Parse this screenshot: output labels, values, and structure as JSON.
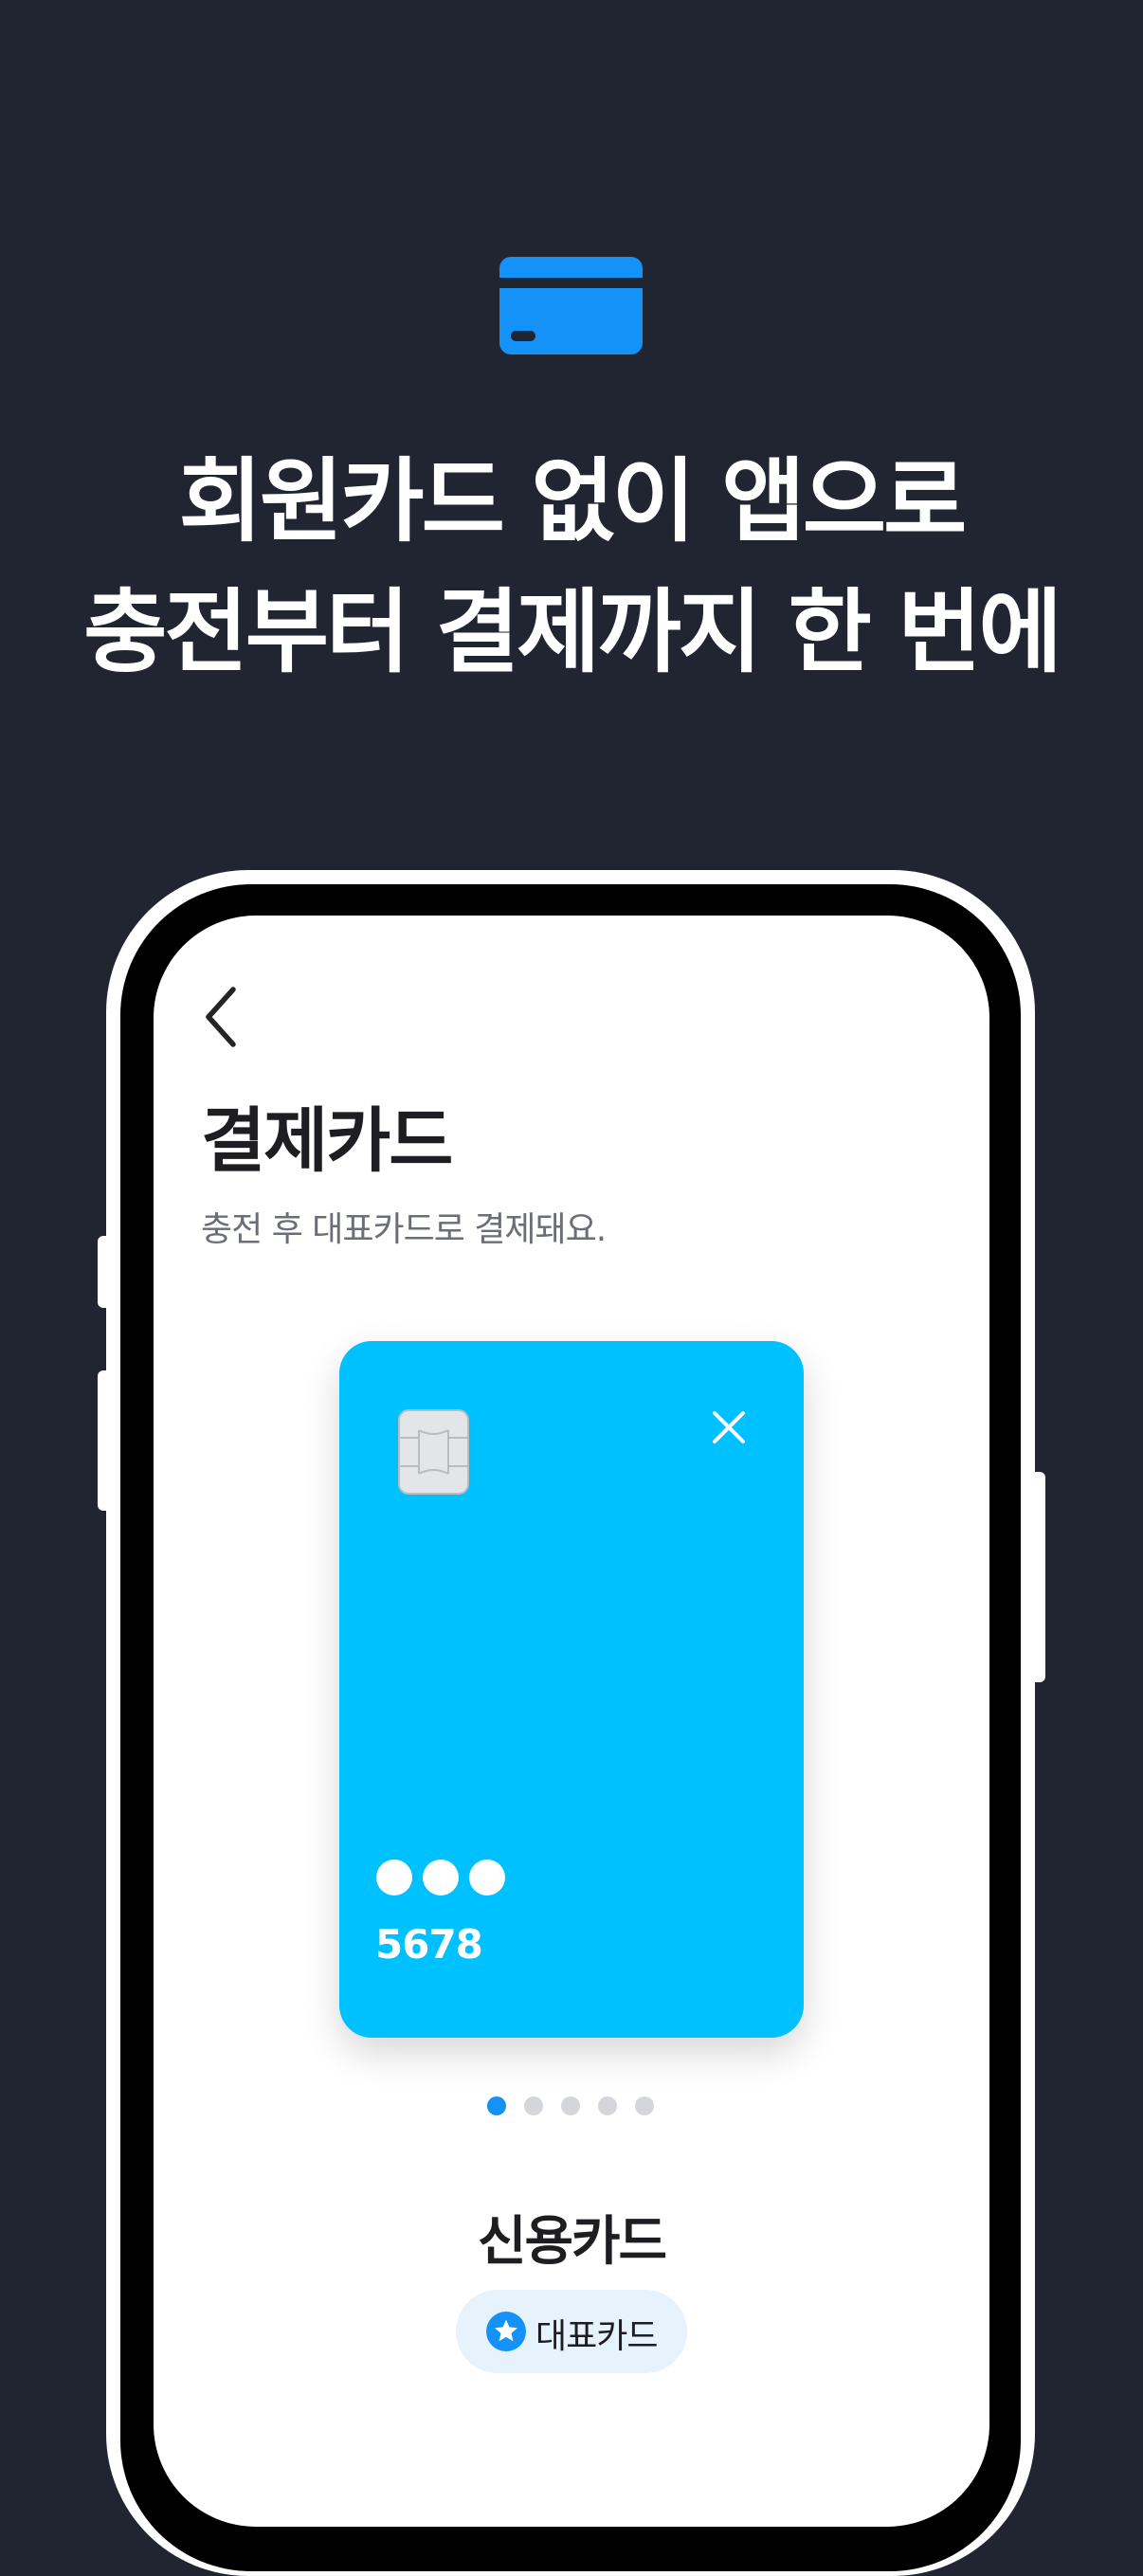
{
  "hero": {
    "icon": "credit-card-icon",
    "icon_color": "#1592f7",
    "headline_line1": "회원카드 없이 앱으로",
    "headline_line2": "충전부터 결제까지 한 번에"
  },
  "screen": {
    "back_icon": "chevron-left-icon",
    "title": "결제카드",
    "subtitle": "충전 후 대표카드로 결제돼요.",
    "card": {
      "color": "#00c1ff",
      "chip_icon": "card-chip-icon",
      "close_icon": "close-icon",
      "masked_dots": "●●●",
      "number": "5678"
    },
    "pager": {
      "count": 5,
      "active": 1,
      "active_color": "#1592f7",
      "inactive_color": "#d4d6da"
    },
    "card_name": "신용카드",
    "badge": {
      "icon": "star-icon",
      "label": "대표카드",
      "color": "#1592f7"
    }
  }
}
